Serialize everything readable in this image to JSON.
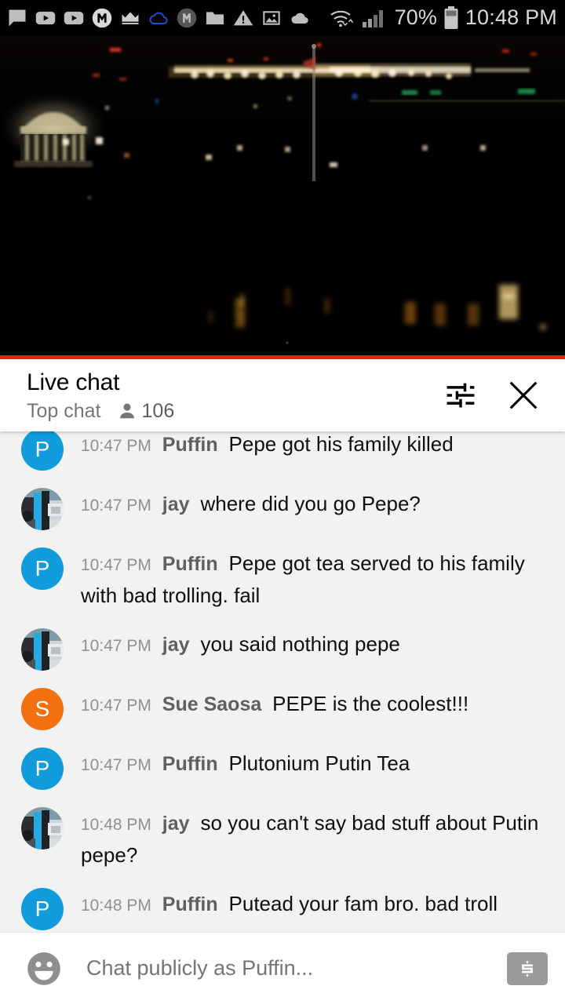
{
  "statusbar": {
    "icons": [
      {
        "name": "chat-bubble-icon"
      },
      {
        "name": "youtube-icon"
      },
      {
        "name": "youtube-icon-2"
      },
      {
        "name": "messenger-m-icon"
      },
      {
        "name": "crown-icon"
      },
      {
        "name": "cloud-outline-icon"
      },
      {
        "name": "monogram-m-icon"
      },
      {
        "name": "folder-icon"
      },
      {
        "name": "warning-triangle-icon"
      },
      {
        "name": "image-icon"
      },
      {
        "name": "cloud-filled-icon"
      }
    ],
    "wifi_icon": "wifi-icon",
    "signal_icon": "cellular-signal-icon",
    "battery_percent": "70%",
    "battery_icon": "battery-icon",
    "clock": "10:48 PM"
  },
  "video": {
    "name": "live-video-player",
    "description": "Night cityscape with illuminated memorial dome and city lights",
    "progress_color": "#e62117",
    "progress_percent": 100
  },
  "chat_header": {
    "title": "Live chat",
    "subtitle": "Top chat",
    "viewer_icon": "person-icon",
    "viewer_count": "106",
    "settings_icon": "tune-sliders-icon",
    "close_icon": "close-x-icon"
  },
  "messages": [
    {
      "time": "10:47 PM",
      "author": "Puffin",
      "text": "Pepe got his family killed",
      "avatar_type": "letter",
      "avatar_letter": "P",
      "avatar_color": "#0f9bdc",
      "clipped": true
    },
    {
      "time": "10:47 PM",
      "author": "jay",
      "text": "where did you go Pepe?",
      "avatar_type": "photo",
      "avatar_letter": "",
      "avatar_color": "#2b7fa8",
      "clipped": false
    },
    {
      "time": "10:47 PM",
      "author": "Puffin",
      "text": "Pepe got tea served to his family with bad trolling. fail",
      "avatar_type": "letter",
      "avatar_letter": "P",
      "avatar_color": "#0f9bdc",
      "clipped": false
    },
    {
      "time": "10:47 PM",
      "author": "jay",
      "text": "you said nothing pepe",
      "avatar_type": "photo",
      "avatar_letter": "",
      "avatar_color": "#2b7fa8",
      "clipped": false
    },
    {
      "time": "10:47 PM",
      "author": "Sue Saosa",
      "text": "PEPE is the coolest!!!",
      "avatar_type": "letter",
      "avatar_letter": "S",
      "avatar_color": "#f2700f",
      "clipped": false
    },
    {
      "time": "10:47 PM",
      "author": "Puffin",
      "text": "Plutonium Putin Tea",
      "avatar_type": "letter",
      "avatar_letter": "P",
      "avatar_color": "#0f9bdc",
      "clipped": false
    },
    {
      "time": "10:48 PM",
      "author": "jay",
      "text": "so you can't say bad stuff about Putin pepe?",
      "avatar_type": "photo",
      "avatar_letter": "",
      "avatar_color": "#2b7fa8",
      "clipped": false
    },
    {
      "time": "10:48 PM",
      "author": "Puffin",
      "text": "Putead your fam bro. bad troll",
      "avatar_type": "letter",
      "avatar_letter": "P",
      "avatar_color": "#0f9bdc",
      "clipped": false
    }
  ],
  "chat_input": {
    "emoji_icon": "emoji-smiley-icon",
    "placeholder": "Chat publicly as Puffin...",
    "value": "",
    "superchat_icon": "dollar-bill-icon"
  }
}
